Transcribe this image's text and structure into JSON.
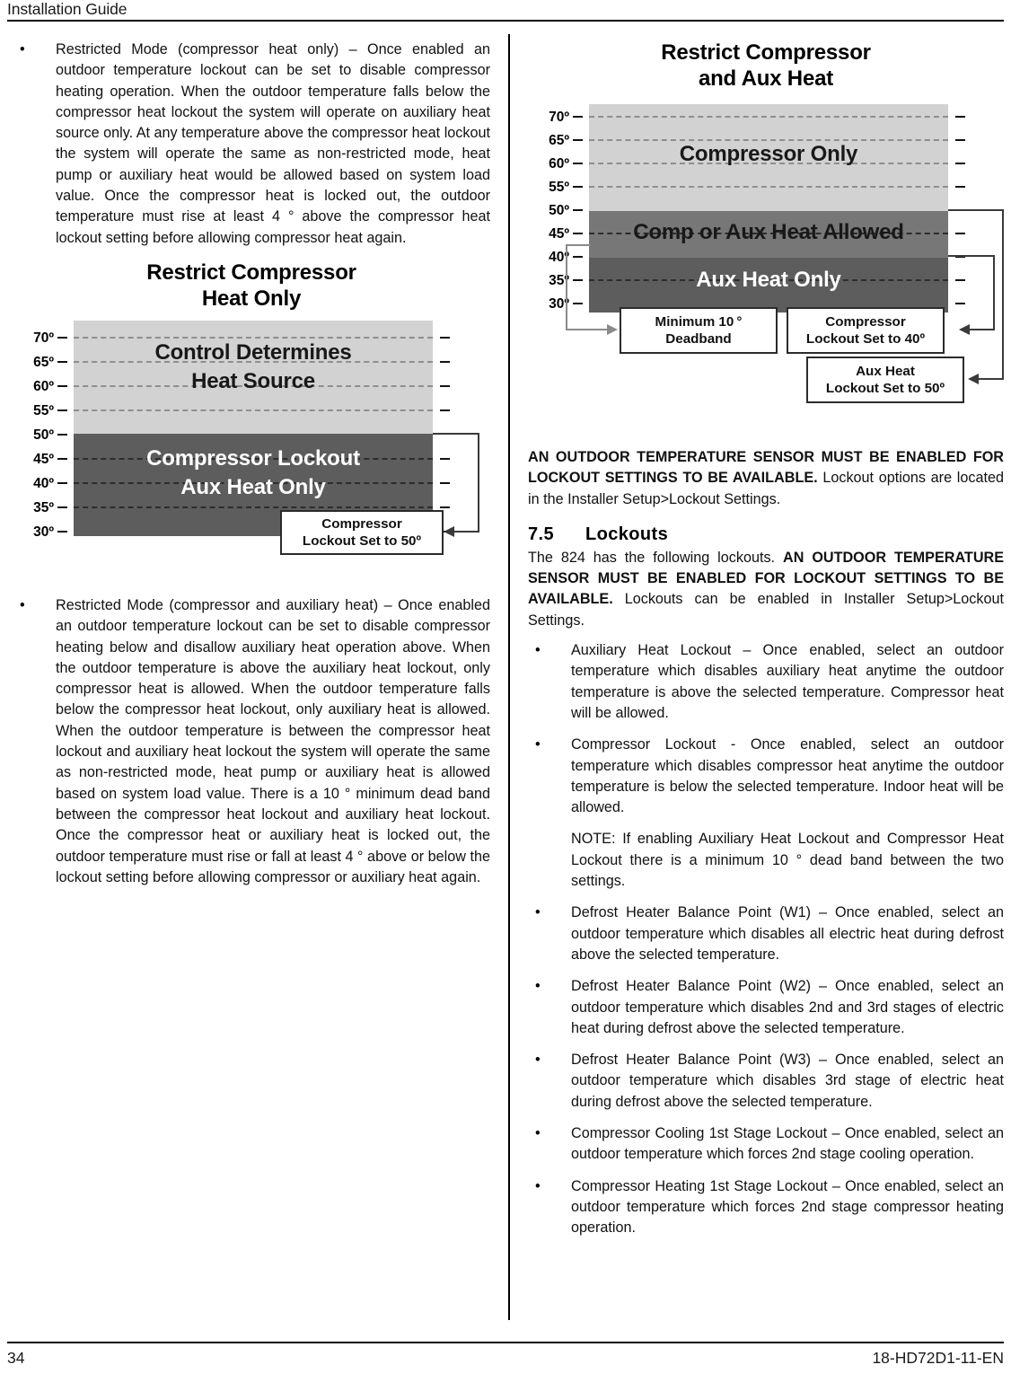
{
  "header": {
    "title": "Installation Guide"
  },
  "footer": {
    "page_number": "34",
    "doc_code": "18-HD72D1-11-EN"
  },
  "left_column": {
    "bullet_1": {
      "marker": "•",
      "text": "Restricted Mode (compressor heat only) – Once enabled an outdoor temperature lockout can be set to disable compressor heating operation. When the outdoor temperature falls below the compressor heat lockout the system will operate on auxiliary heat source only. At any temperature above the compressor heat lockout the system will operate the same as non-restricted mode, heat pump or auxiliary heat would be allowed based on system load value. Once the compressor heat is locked out, the outdoor temperature must rise at least 4 ° above the compressor heat lockout setting before allowing compressor heat again."
    },
    "bullet_2": {
      "marker": "•",
      "text": "Restricted Mode (compressor and auxiliary heat) – Once enabled an outdoor temperature lockout can be set to disable compressor heating below and disallow auxiliary heat operation above. When the outdoor temperature is above the auxiliary heat lockout, only compressor heat is allowed. When the outdoor temperature falls below the compressor heat lockout, only auxiliary heat is allowed. When the outdoor temperature is between the compressor heat lockout and auxiliary heat lockout the system will operate the same as non-restricted mode, heat pump or auxiliary heat is allowed based on system load value. There is a 10 ° minimum dead band between the compressor heat lockout and auxiliary heat lockout. Once the compressor heat or auxiliary heat is locked out, the outdoor temperature must rise or fall at least 4 ° above or below the lockout setting before allowing compressor or auxiliary heat again."
    }
  },
  "right_column": {
    "note_paragraph": {
      "bold_part": "AN OUTDOOR TEMPERATURE SENSOR MUST BE ENABLED FOR LOCKOUT SETTINGS TO BE AVAILABLE.",
      "normal_part": " Lockout options are located in the Installer Setup>Lockout Settings."
    },
    "section": {
      "number": "7.5",
      "title": "Lockouts"
    },
    "intro": {
      "pre": "The 824 has the following lockouts. ",
      "bold": "AN OUTDOOR TEMPERATURE SENSOR MUST BE ENABLED FOR LOCKOUT SETTINGS TO BE AVAILABLE.",
      "post": " Lockouts can be enabled in Installer Setup>Lockout Settings."
    },
    "bullets": [
      {
        "marker": "•",
        "text": "Auxiliary Heat Lockout – Once enabled, select an outdoor temperature which disables auxiliary heat anytime the outdoor temperature is above the selected temperature. Compressor heat will be allowed."
      },
      {
        "marker": "•",
        "text": "Compressor Lockout - Once enabled, select an outdoor temperature which disables compressor heat anytime the outdoor temperature is below the selected temperature. Indoor heat will be allowed."
      },
      {
        "marker": "",
        "text": "NOTE: If enabling Auxiliary Heat Lockout and Compressor Heat Lockout there is a minimum 10 ° dead band between the two settings."
      },
      {
        "marker": "•",
        "text": "Defrost Heater Balance Point (W1) – Once enabled, select an outdoor temperature which disables all electric heat during defrost above the selected temperature."
      },
      {
        "marker": "•",
        "text": "Defrost Heater Balance Point (W2) – Once enabled, select an outdoor temperature which disables 2nd and 3rd stages of electric heat during defrost above the selected temperature."
      },
      {
        "marker": "•",
        "text": "Defrost Heater Balance Point (W3) – Once enabled, select an outdoor temperature which disables 3rd stage of electric heat during defrost above the selected temperature."
      },
      {
        "marker": "•",
        "text": "Compressor Cooling 1st Stage Lockout – Once enabled, select an outdoor temperature which forces 2nd stage cooling operation."
      },
      {
        "marker": "•",
        "text": "Compressor Heating 1st Stage Lockout – Once enabled, select an outdoor temperature which forces 2nd stage compressor heating operation."
      }
    ]
  },
  "chart_data": [
    {
      "id": "chart-compressor-heat-only",
      "type": "bar",
      "title": "Restrict Compressor\nHeat Only",
      "title_line1": "Restrict Compressor",
      "title_line2": "Heat Only",
      "ylabel": "",
      "xlabel": "",
      "ylim": [
        28,
        72
      ],
      "grid": true,
      "tick_labels": [
        "70º",
        "65º",
        "60º",
        "55º",
        "50º",
        "45º",
        "40º",
        "35º",
        "30º"
      ],
      "tick_values": [
        70,
        65,
        60,
        55,
        50,
        45,
        40,
        35,
        30
      ],
      "bands": [
        {
          "label": "Control Determines Heat Source",
          "label_line1": "Control Determines",
          "label_line2": "Heat Source",
          "from": 50,
          "to": 72,
          "color": "#d2d2d2",
          "text_color": "#181818"
        },
        {
          "label": "Compressor Lockout Aux Heat Only",
          "label_line1": "Compressor Lockout",
          "label_line2": "Aux Heat Only",
          "from": 30,
          "to": 50,
          "color": "#5d5d5d",
          "text_color": "#ffffff"
        }
      ],
      "annotations": [
        {
          "name": "compressor-lockout-callout",
          "line1": "Compressor",
          "line2": "Lockout Set to 50º",
          "points_to": 50
        }
      ]
    },
    {
      "id": "chart-compressor-and-aux-heat",
      "type": "bar",
      "title": "Restrict Compressor\nand Aux Heat",
      "title_line1": "Restrict Compressor",
      "title_line2": "and Aux Heat",
      "ylabel": "",
      "xlabel": "",
      "ylim": [
        28,
        72
      ],
      "grid": true,
      "tick_labels": [
        "70º",
        "65º",
        "60º",
        "55º",
        "50º",
        "45º",
        "40º",
        "35º",
        "30º"
      ],
      "tick_values": [
        70,
        65,
        60,
        55,
        50,
        45,
        40,
        35,
        30
      ],
      "bands": [
        {
          "label": "Compressor Only",
          "from": 50,
          "to": 72,
          "color": "#d2d2d2",
          "text_color": "#181818"
        },
        {
          "label": "Comp or Aux Heat Allowed",
          "from": 40,
          "to": 50,
          "color": "#777777",
          "text_color": "#181818"
        },
        {
          "label": "Aux Heat Only",
          "from": 30,
          "to": 40,
          "color": "#5d5d5d",
          "text_color": "#ffffff"
        }
      ],
      "annotations": [
        {
          "name": "minimum-deadband-callout",
          "line1": "Minimum 10 °",
          "line2": "Deadband",
          "points_to": 40
        },
        {
          "name": "compressor-lockout-callout",
          "line1": "Compressor",
          "line2": "Lockout Set to 40º",
          "points_to": 40
        },
        {
          "name": "aux-heat-lockout-callout",
          "line1": "Aux Heat",
          "line2": "Lockout Set to 50º",
          "points_to": 50
        }
      ]
    }
  ]
}
